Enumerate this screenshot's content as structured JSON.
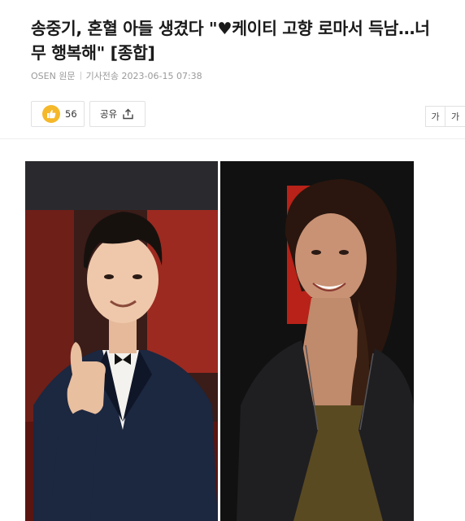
{
  "article": {
    "headline_line1": "송중기, 혼혈 아들 생겼다 \"♥케이티 고향 로마서 득남…너",
    "headline_line2": "무 행복해\" [종합]",
    "source": "OSEN 원문",
    "timestamp": "기사전송 2023-06-15 07:38"
  },
  "actions": {
    "reaction_count": "56",
    "share_label": "공유",
    "font_small_label": "가",
    "font_large_label": "가"
  },
  "icons": {
    "reaction": "thumbs-up-icon",
    "share": "share-icon"
  },
  "colors": {
    "reaction_badge": "#f5b82a",
    "headline_text": "#1a1a1a",
    "meta_text": "#9a9a9a"
  }
}
